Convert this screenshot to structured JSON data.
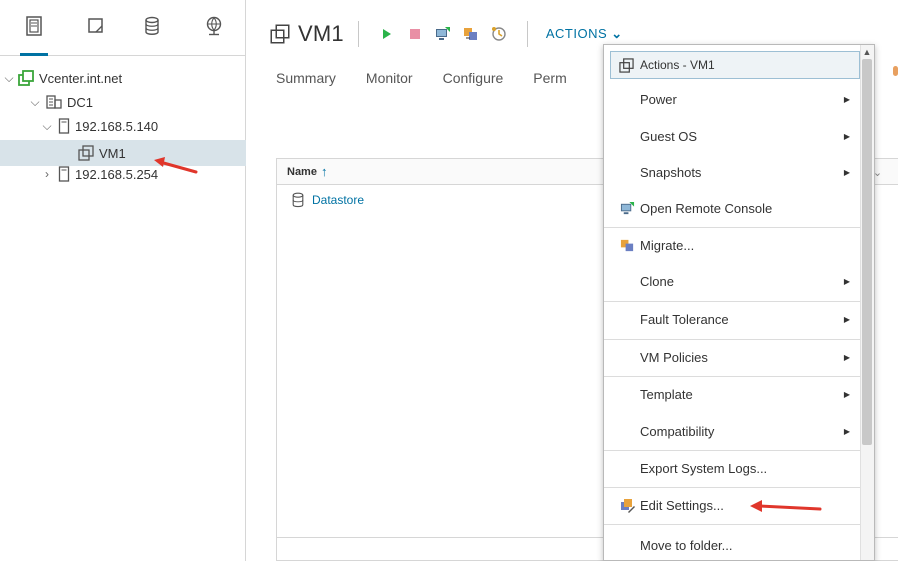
{
  "navigator": {
    "tabs": [
      {
        "icon": "hosts-clusters-icon",
        "active": true
      },
      {
        "icon": "vms-templates-icon",
        "active": false
      },
      {
        "icon": "storage-icon",
        "active": false
      },
      {
        "icon": "networking-icon",
        "active": false
      }
    ],
    "tree": {
      "vcenter": "Vcenter.int.net",
      "datacenter": "DC1",
      "host1": "192.168.5.140",
      "vm": "VM1",
      "host2": "192.168.5.254"
    }
  },
  "header": {
    "title": "VM1",
    "actions_label": "ACTIONS",
    "actions_chevron": "⌄"
  },
  "tabs": [
    "Summary",
    "Monitor",
    "Configure",
    "Perm"
  ],
  "grid": {
    "column_name": "Name",
    "sort_arrow": "↑",
    "rows": [
      "Datastore"
    ],
    "col_toggle": "⌄"
  },
  "menu": {
    "header": "Actions - VM1",
    "items": {
      "power": "Power",
      "guest_os": "Guest OS",
      "snapshots": "Snapshots",
      "remote_console": "Open Remote Console",
      "migrate": "Migrate...",
      "clone": "Clone",
      "fault_tolerance": "Fault Tolerance",
      "vm_policies": "VM Policies",
      "template": "Template",
      "compatibility": "Compatibility",
      "export_logs": "Export System Logs...",
      "edit_settings": "Edit Settings...",
      "move_to_folder": "Move to folder..."
    },
    "submenu_glyph": "▶"
  },
  "colors": {
    "accent": "#0072a3",
    "selection": "#d8e3e9",
    "annotation_arrow": "#e0362b",
    "play_green": "#2bb34a",
    "stop_pink": "#e98fa5"
  }
}
